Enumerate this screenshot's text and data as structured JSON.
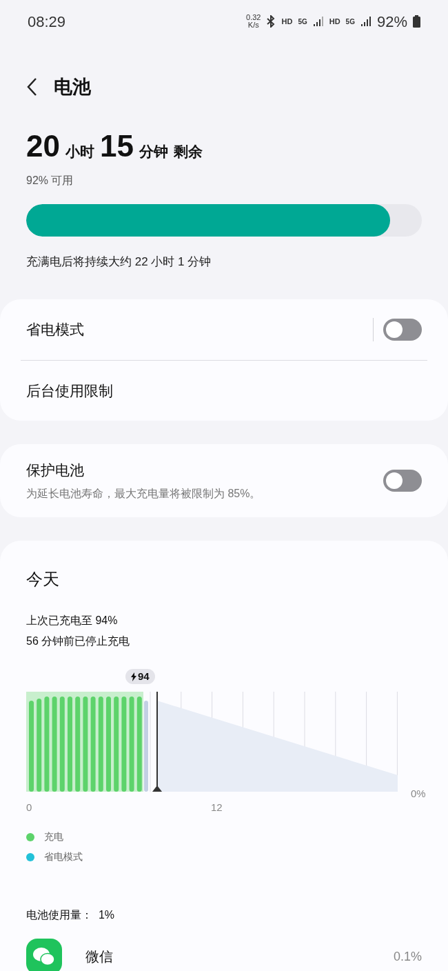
{
  "status_bar": {
    "time": "08:29",
    "speed_value": "0.32",
    "speed_unit": "K/s",
    "network_1": "HD",
    "network_2": "5G",
    "network_3": "HD",
    "network_4": "5G",
    "battery": "92%"
  },
  "header": {
    "title": "电池"
  },
  "summary": {
    "hours": "20",
    "hours_unit": "小时",
    "minutes": "15",
    "minutes_unit": "分钟",
    "suffix": "剩余",
    "available": "92% 可用",
    "level": 0.92,
    "full_charge_note": "充满电后将持续大约 22 小时 1 分钟"
  },
  "settings_card": [
    {
      "kind": "toggle",
      "label": "省电模式",
      "on": false
    },
    {
      "kind": "link",
      "label": "后台使用限制"
    }
  ],
  "protect_card": {
    "label": "保护电池",
    "description": "为延长电池寿命，最大充电量将被限制为 85%。",
    "on": false
  },
  "today": {
    "title": "今天",
    "last_charge": "上次已充电至 94%",
    "stopped": "56 分钟前已停止充电",
    "chart": {
      "badge": "94",
      "x_start": "0",
      "x_mid": "12",
      "y_label": "0%"
    },
    "legend": [
      {
        "label": "充电",
        "color": "#5dd36b"
      },
      {
        "label": "省电模式",
        "color": "#22c1d8"
      }
    ],
    "usage": "电池使用量：  1%",
    "apps": [
      {
        "name": "微信",
        "percent": "0.1%"
      }
    ]
  }
}
